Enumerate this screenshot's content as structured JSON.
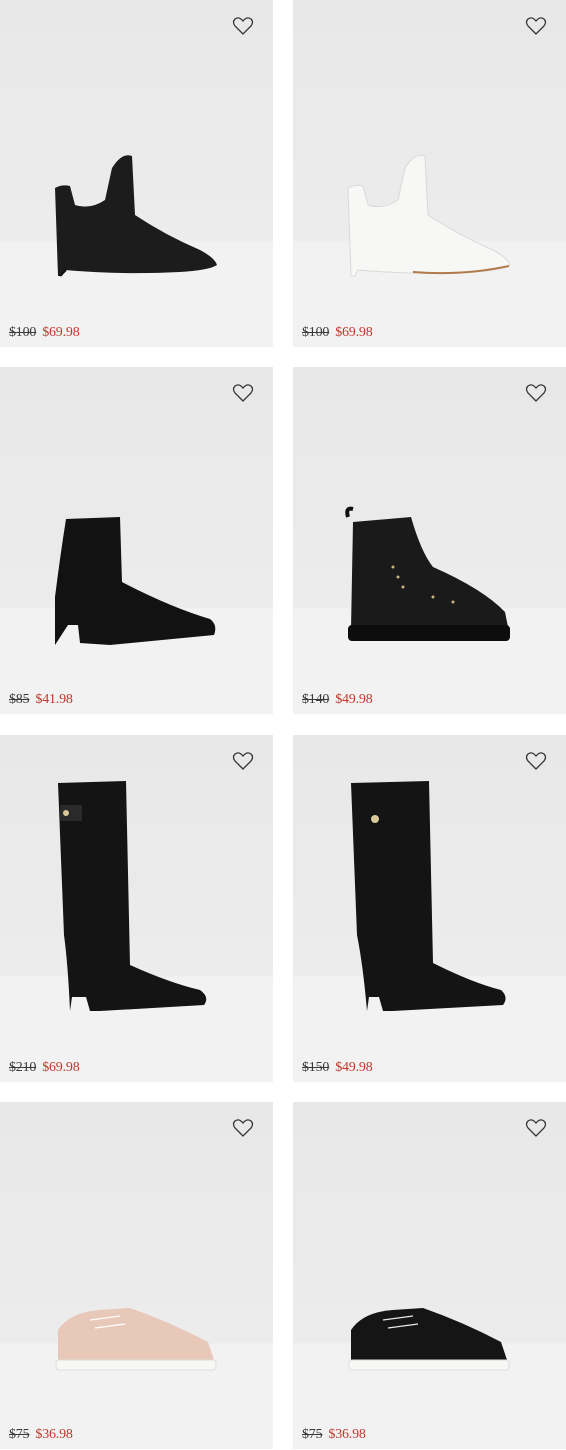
{
  "products": [
    {
      "original_price": "$100",
      "sale_price": "$69.98",
      "shoe": "black-pointed-mule"
    },
    {
      "original_price": "$100",
      "sale_price": "$69.98",
      "shoe": "white-pointed-mule"
    },
    {
      "original_price": "$85",
      "sale_price": "$41.98",
      "shoe": "black-sock-ankle-boot"
    },
    {
      "original_price": "$140",
      "sale_price": "$49.98",
      "shoe": "black-lug-combat-boot"
    },
    {
      "original_price": "$210",
      "sale_price": "$69.98",
      "shoe": "black-knee-high-boot-buckle"
    },
    {
      "original_price": "$150",
      "sale_price": "$49.98",
      "shoe": "black-knee-high-boot-button"
    },
    {
      "original_price": "$75",
      "sale_price": "$36.98",
      "shoe": "blush-quilted-sneaker"
    },
    {
      "original_price": "$75",
      "sale_price": "$36.98",
      "shoe": "black-quilted-sneaker"
    }
  ],
  "icons": {
    "wishlist": "heart-outline-icon"
  },
  "colors": {
    "sale": "#c0392b",
    "card_bg": "#ececec"
  }
}
